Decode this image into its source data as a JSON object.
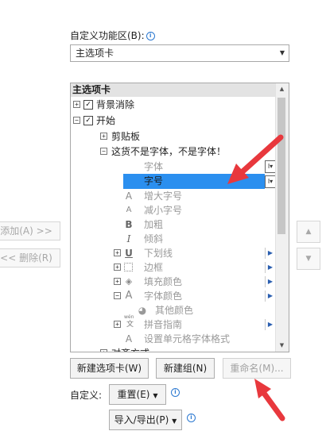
{
  "customize_ribbon": {
    "label": "自定义功能区(B):",
    "dropdown_value": "主选项卡"
  },
  "tree": {
    "header": "主选项卡",
    "items": {
      "background_removal": "背景消除",
      "start": "开始",
      "clipboard": "剪贴板",
      "custom_group": "这货不是字体，不是字体！",
      "font": "字体",
      "font_size": "字号",
      "grow_font": "增大字号",
      "shrink_font": "减小字号",
      "bold": "加粗",
      "italic": "倾斜",
      "underline": "下划线",
      "borders": "边框",
      "fill_color": "填充颜色",
      "font_color": "字体颜色",
      "other_colors": "其他颜色",
      "phonetic": "拼音指南",
      "format_cells_font": "设置单元格字体格式",
      "alignment": "对齐方式"
    },
    "icon_letters": {
      "grow": "A",
      "shrink": "A",
      "bold": "B",
      "italic": "I",
      "underline": "U",
      "font_color": "A",
      "format_cells": "A",
      "phonetic": "wén"
    }
  },
  "side_buttons": {
    "add": "添加(A) >>",
    "remove": "<< 删除(R)"
  },
  "buttons": {
    "new_tab": "新建选项卡(W)",
    "new_group": "新建组(N)",
    "rename": "重命名(M)..."
  },
  "customizations": {
    "label": "自定义:",
    "reset": "重置(E)",
    "import_export": "导入/导出(P)"
  },
  "colors": {
    "selection": "#2b8fef",
    "annotation_arrow": "#e8383d"
  },
  "icons": [
    "info-icon",
    "dropdown-arrow-icon",
    "expand-icon",
    "collapse-icon",
    "checkbox-icon",
    "scroll-up-icon",
    "scroll-down-icon",
    "move-up-icon",
    "move-down-icon",
    "submenu-arrow-icon",
    "annotation-arrow"
  ]
}
